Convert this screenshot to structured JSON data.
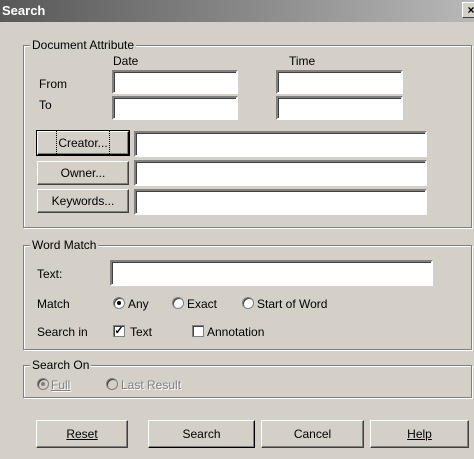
{
  "window": {
    "title": "Search",
    "close_glyph": "×"
  },
  "document_attribute": {
    "group_label": "Document Attribute",
    "date_header": "Date",
    "time_header": "Time",
    "from_label": "From",
    "to_label": "To",
    "from_date": "",
    "from_time": "",
    "to_date": "",
    "to_time": "",
    "creator_button": "Creator...",
    "owner_button": "Owner...",
    "keywords_button": "Keywords...",
    "creator_value": "",
    "owner_value": "",
    "keywords_value": ""
  },
  "word_match": {
    "group_label": "Word Match",
    "text_label": "Text:",
    "text_value": "",
    "match_label": "Match",
    "match_options": [
      {
        "label": "Any",
        "selected": true
      },
      {
        "label": "Exact",
        "selected": false
      },
      {
        "label": "Start of Word",
        "selected": false
      }
    ],
    "search_in_label": "Search in",
    "search_in_options": [
      {
        "label": "Text",
        "checked": true
      },
      {
        "label": "Annotation",
        "checked": false
      }
    ]
  },
  "search_on": {
    "group_label": "Search On",
    "options": [
      {
        "label": "Full",
        "selected": true,
        "enabled": false
      },
      {
        "label": "Last Result",
        "selected": false,
        "enabled": false
      }
    ]
  },
  "buttons": {
    "reset": "Reset",
    "search": "Search",
    "cancel": "Cancel",
    "help": "Help"
  },
  "icons": {
    "close": "close-icon",
    "check": "checkmark-icon"
  }
}
